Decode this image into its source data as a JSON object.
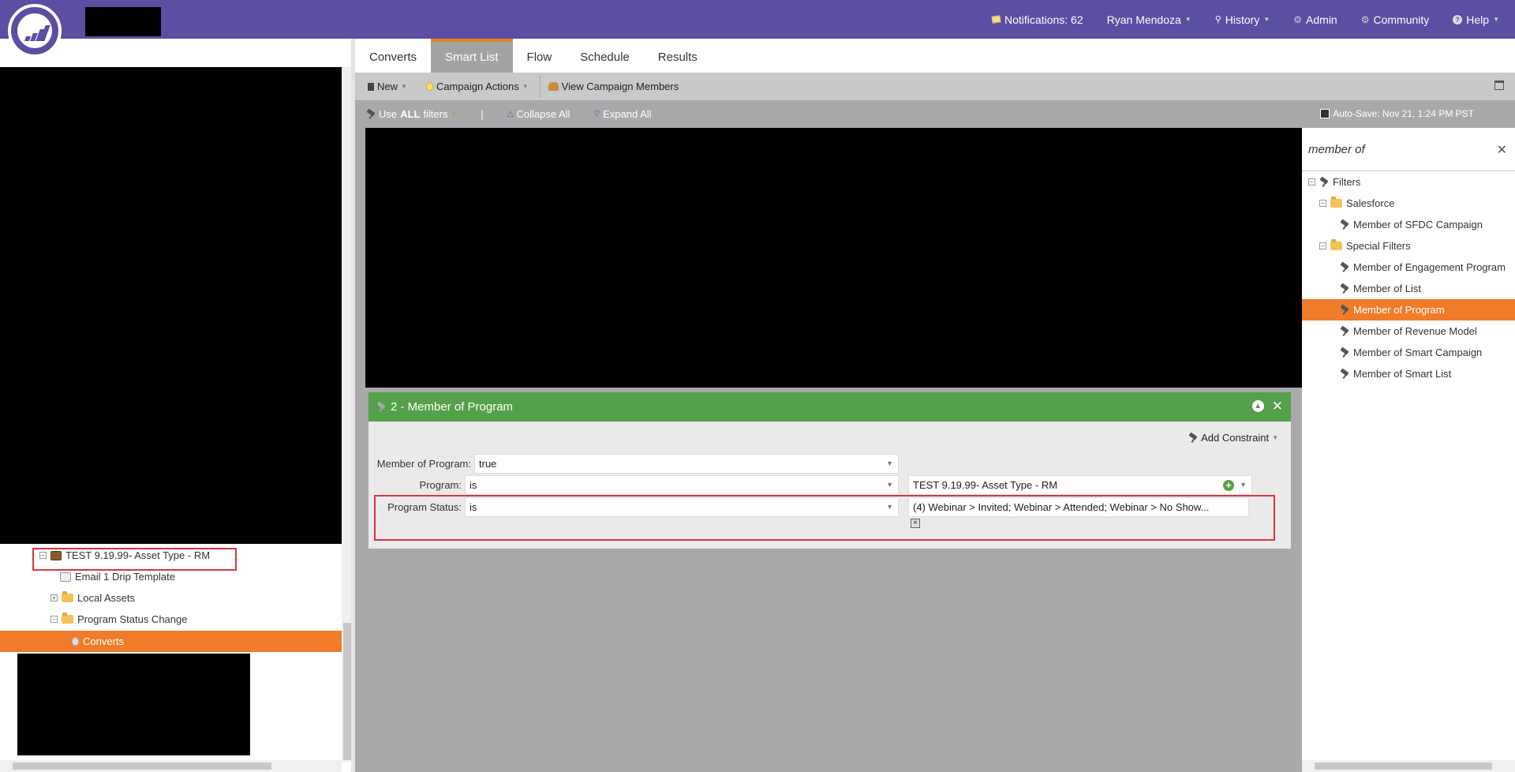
{
  "topbar": {
    "notifications": "Notifications: 62",
    "user": "Ryan Mendoza",
    "history": "History",
    "admin": "Admin",
    "community": "Community",
    "help": "Help"
  },
  "sidebar": {
    "items": [
      {
        "label": "TEST 9.19.99- Asset Type - RM",
        "toggle": "−"
      },
      {
        "label": "Email 1 Drip Template"
      },
      {
        "label": "Local Assets",
        "toggle": "+"
      },
      {
        "label": "Program Status Change",
        "toggle": "−"
      },
      {
        "label": "Converts"
      }
    ]
  },
  "tabs": [
    "Converts",
    "Smart List",
    "Flow",
    "Schedule",
    "Results"
  ],
  "toolbar": {
    "new": "New",
    "campaign_actions": "Campaign Actions",
    "view_members": "View Campaign Members"
  },
  "filterbar": {
    "use_prefix": "Use",
    "use_all": "ALL",
    "use_suffix": "filters",
    "separator": "|",
    "collapse": "Collapse All",
    "expand": "Expand All",
    "autosave": "Auto-Save: Nov 21, 1:24 PM PST"
  },
  "card": {
    "title": "2 - Member of Program",
    "add_constraint": "Add Constraint",
    "rows": [
      {
        "label": "Member of Program:",
        "operator": "true"
      },
      {
        "label": "Program:",
        "operator": "is",
        "value": "TEST 9.19.99- Asset Type - RM"
      },
      {
        "label": "Program Status:",
        "operator": "is",
        "value": "(4) Webinar > Invited; Webinar > Attended; Webinar > No Show..."
      }
    ]
  },
  "rpanel": {
    "search": "member of",
    "root": "Filters",
    "groups": [
      {
        "label": "Salesforce",
        "items": [
          "Member of SFDC Campaign"
        ]
      },
      {
        "label": "Special Filters",
        "items": [
          "Member of Engagement Program",
          "Member of List",
          "Member of Program",
          "Member of Revenue Model",
          "Member of Smart Campaign",
          "Member of Smart List"
        ]
      }
    ]
  },
  "colors": {
    "topbar": "#5a4fa2",
    "accent_orange": "#f07c2a",
    "card_green": "#55a04a",
    "highlight_red": "#d9363e"
  }
}
